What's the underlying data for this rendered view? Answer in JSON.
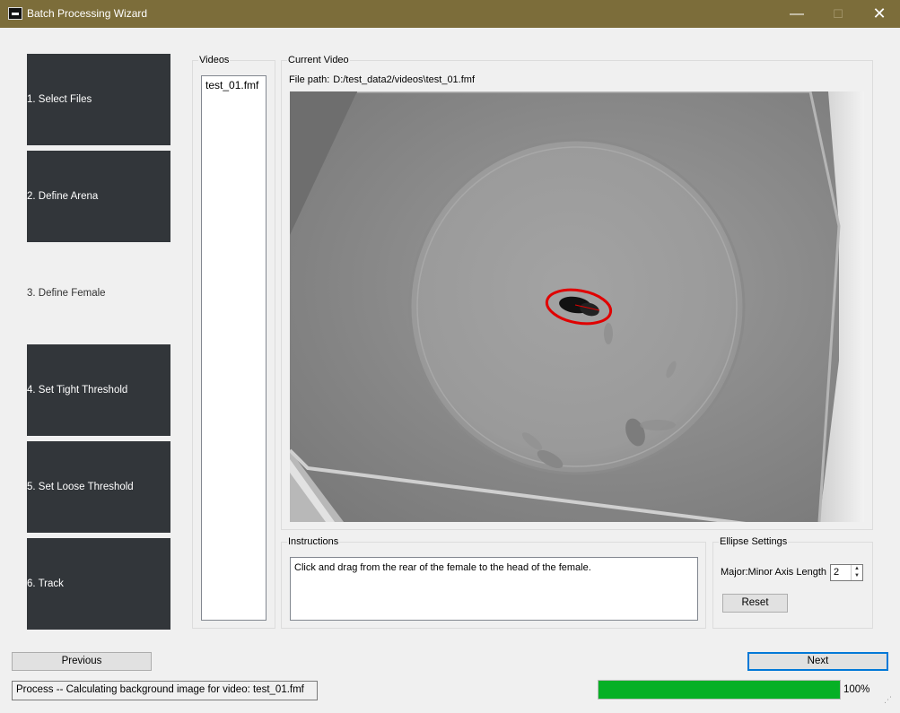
{
  "window": {
    "title": "Batch Processing Wizard",
    "minimize": "—",
    "maximize": "☐",
    "close": "✕"
  },
  "steps": [
    {
      "label": "1. Select Files"
    },
    {
      "label": "2. Define Arena"
    },
    {
      "label": "3. Define Female"
    },
    {
      "label": "4. Set Tight Threshold"
    },
    {
      "label": "5. Set Loose Threshold"
    },
    {
      "label": "6. Track"
    }
  ],
  "videos": {
    "title": "Videos",
    "items": [
      "test_01.fmf"
    ]
  },
  "current_video": {
    "title": "Current Video",
    "file_path_label": "File path:",
    "file_path": "D:/test_data2/videos\\test_01.fmf"
  },
  "instructions": {
    "title": "Instructions",
    "text": "Click and drag from the rear of the female to the head of the female."
  },
  "ellipse_settings": {
    "title": "Ellipse Settings",
    "axis_label": "Major:Minor Axis Length",
    "axis_value": "2",
    "reset_label": "Reset"
  },
  "nav": {
    "previous_label": "Previous",
    "next_label": "Next"
  },
  "status": {
    "text": "Process -- Calculating background image for video: test_01.fmf",
    "progress": 1.0,
    "progress_text": "100%"
  },
  "colors": {
    "titlebar": "#7c6d3a",
    "step_bg": "#32363a",
    "progress_fill": "#06b025",
    "ellipse": "#e00000",
    "next_focus": "#0078d7"
  }
}
